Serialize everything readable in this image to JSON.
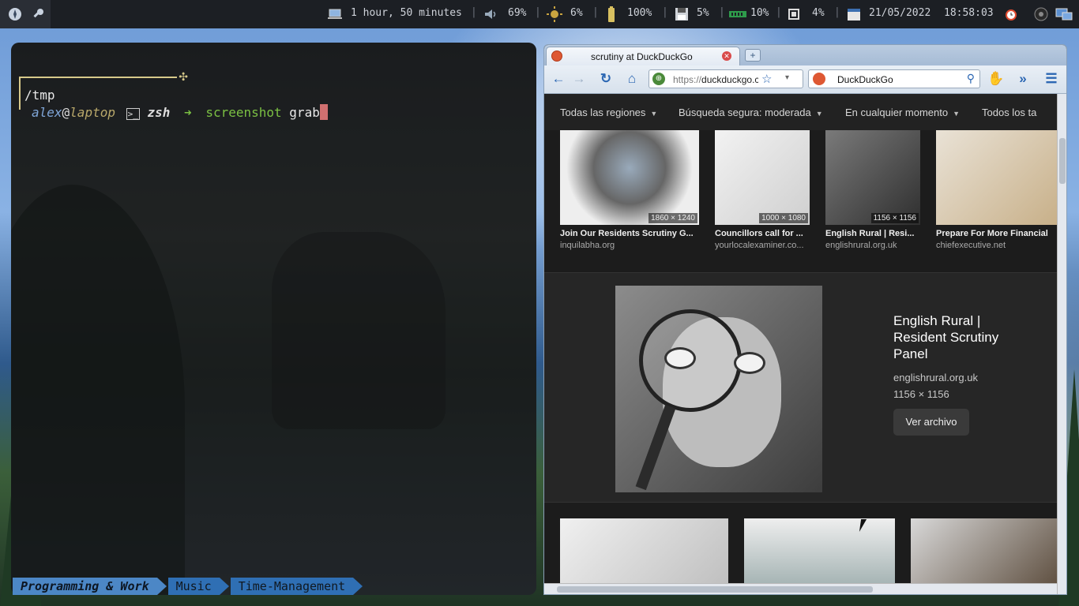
{
  "topbar": {
    "battery_time": "1 hour, 50 minutes",
    "volume": "69%",
    "brightness": "6%",
    "battery": "100%",
    "disk": "5%",
    "memory": "10%",
    "cpu": "4%",
    "date": "21/05/2022",
    "time": "18:58:03",
    "icons": [
      "compass-icon",
      "key-icon",
      "laptop-icon",
      "speaker-icon",
      "sun-icon",
      "battery-icon",
      "floppy-icon",
      "ram-icon",
      "cpu-icon",
      "calendar-icon",
      "alarm-icon",
      "network-icon",
      "display-icon"
    ]
  },
  "terminal": {
    "cwd": "/tmp",
    "user": "alex",
    "at": "@",
    "host": "laptop",
    "shell": "zsh",
    "arrow": "➜",
    "cmd_bin": "screenshot",
    "cmd_arg": "grab"
  },
  "workspaces": [
    {
      "label": "Programming & Work"
    },
    {
      "label": "Music"
    },
    {
      "label": "Time-Management"
    }
  ],
  "browser": {
    "tab_title": "scrutiny at DuckDuckGo",
    "url_prefix": "https://",
    "url_host": "duckduckgo.com/",
    "search_engine": "DuckDuckGo",
    "filters": [
      "Todas las regiones",
      "Búsqueda segura: moderada",
      "En cualquier momento",
      "Todos los ta"
    ],
    "results": [
      {
        "title": "Join Our Residents Scrutiny G...",
        "source": "inquilabha.org",
        "size": "1860 × 1240"
      },
      {
        "title": "Councillors call for ...",
        "source": "yourlocalexaminer.co...",
        "size": "1000 × 1080"
      },
      {
        "title": "English Rural | Resi...",
        "source": "englishrural.org.uk",
        "size": "1156 × 1156"
      },
      {
        "title": "Prepare For More Financial",
        "source": "chiefexecutive.net",
        "size": ""
      }
    ],
    "detail": {
      "title": "English Rural | Resident Scrutiny Panel",
      "source": "englishrural.org.uk",
      "size": "1156 × 1156",
      "button": "Ver archivo"
    }
  },
  "colors": {
    "accent": "#4c87c6",
    "prompt_green": "#7bc043",
    "cursor": "#d07070"
  }
}
